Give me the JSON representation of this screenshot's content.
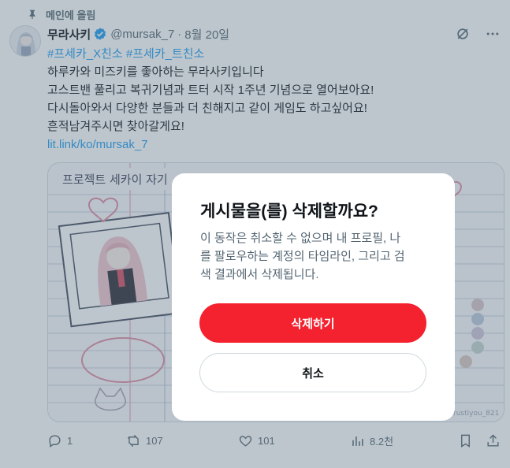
{
  "pinned": {
    "label": "메인에 올림",
    "icon": "pin-icon"
  },
  "tweet": {
    "display_name": "무라사키",
    "handle": "@mursak_7",
    "separator": "·",
    "date": "8월 20일",
    "hashtags": [
      "#프세카_X친소",
      "#프세카_트친소"
    ],
    "lines": [
      "하루카와 미즈키를 좋아하는 무라사키입니다",
      "고스트밴 풀리고 복귀기념과 트터 시작 1주년 기념으로 열어보아요!",
      "다시돌아와서 다양한 분들과 더 친해지고 같이 게임도 하고싶어요!",
      "흔적남겨주시면 찾아갈게요!"
    ],
    "link": "lit.link/ko/mursak_7",
    "media": {
      "notebook_title": "프로젝트 세카이 자기",
      "watermark": "@rustiyou_821"
    }
  },
  "actions": {
    "replies": "1",
    "retweets": "107",
    "likes": "101",
    "views": "8.2천"
  },
  "modal": {
    "title": "게시물을(를) 삭제할까요?",
    "description": [
      "이 동작은 취소할 수 없으며 내 프로필, 나",
      "를 팔로우하는 계정의 타임라인, 그리고 검",
      "색 결과에서 삭제됩니다."
    ],
    "delete_label": "삭제하기",
    "cancel_label": "취소"
  },
  "colors": {
    "accent": "#1d9bf0",
    "danger": "#f4212e",
    "text": "#0f1419",
    "muted": "#536471"
  }
}
